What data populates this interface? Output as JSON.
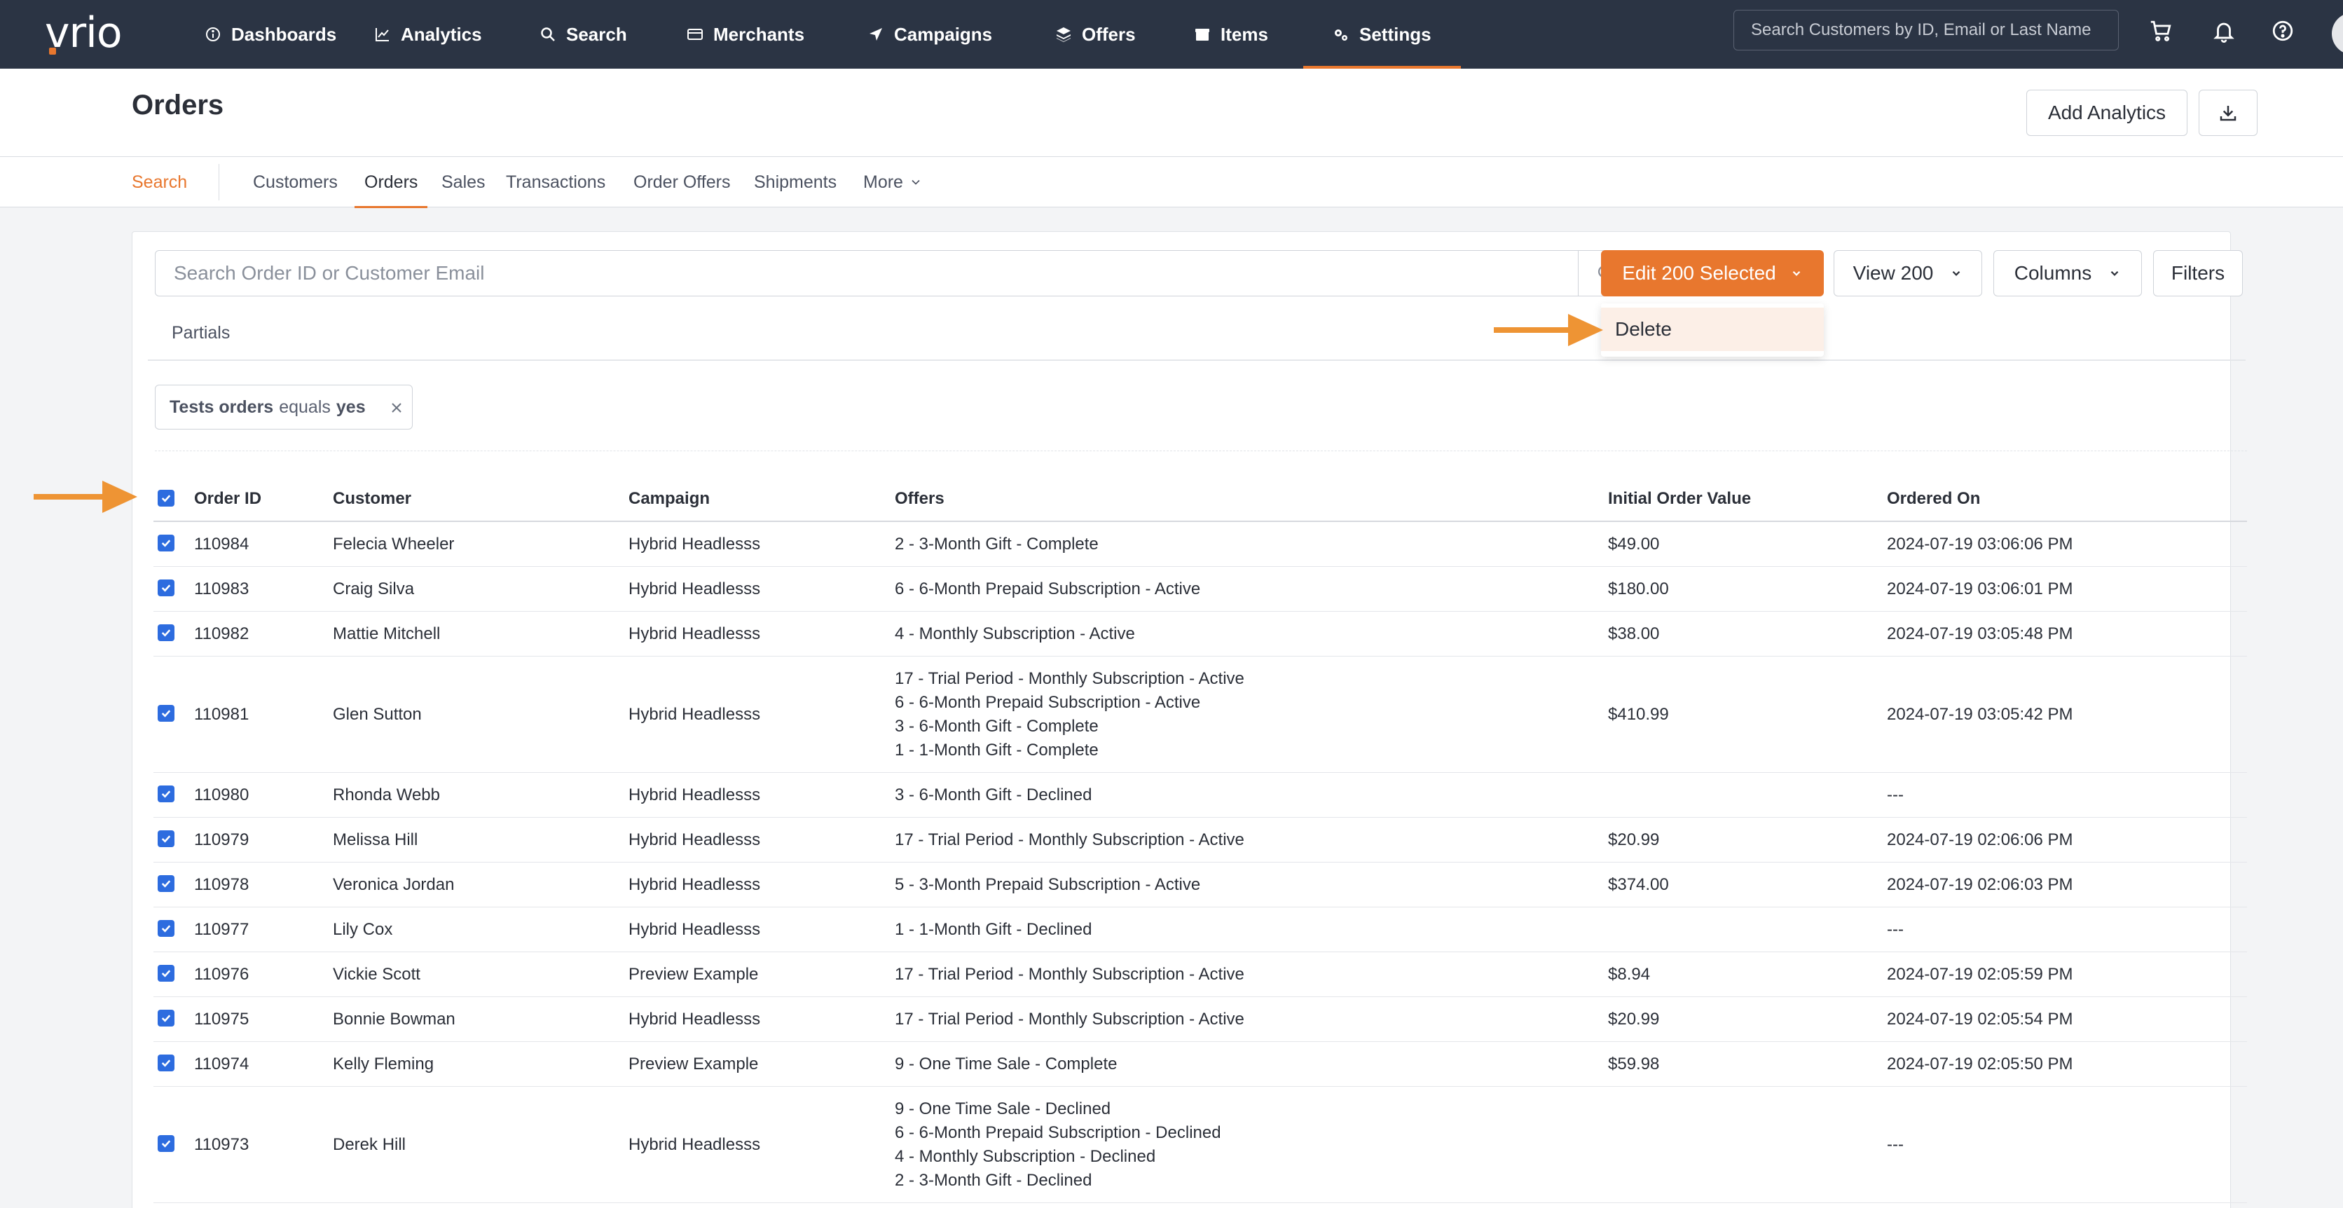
{
  "app": {
    "logo_text": "vrio",
    "colors": {
      "nav_bg": "#2b3444",
      "accent": "#e8772e",
      "checkbox": "#2d6cdf"
    }
  },
  "nav": {
    "items": [
      {
        "label": "Dashboards",
        "icon": "info-icon"
      },
      {
        "label": "Analytics",
        "icon": "chart-line-icon"
      },
      {
        "label": "Search",
        "icon": "search-icon"
      },
      {
        "label": "Merchants",
        "icon": "credit-card-icon"
      },
      {
        "label": "Campaigns",
        "icon": "send-icon"
      },
      {
        "label": "Offers",
        "icon": "layers-icon"
      },
      {
        "label": "Items",
        "icon": "box-icon"
      },
      {
        "label": "Settings",
        "icon": "gears-icon"
      }
    ],
    "search_placeholder": "Search Customers by ID, Email or Last Name"
  },
  "page": {
    "title": "Orders",
    "add_analytics_label": "Add Analytics"
  },
  "subtabs": [
    "Search",
    "Customers",
    "Orders",
    "Sales",
    "Transactions",
    "Order Offers",
    "Shipments",
    "More"
  ],
  "toolbar": {
    "search_placeholder": "Search Order ID or Customer Email",
    "edit_selected_label": "Edit 200 Selected",
    "view_label": "View 200",
    "columns_label": "Columns",
    "filters_label": "Filters",
    "dropdown_delete_label": "Delete"
  },
  "partials_label": "Partials",
  "filter_chip": {
    "field": "Tests orders",
    "operator": "equals",
    "value": "yes"
  },
  "table": {
    "headers": [
      "Order ID",
      "Customer",
      "Campaign",
      "Offers",
      "Initial Order Value",
      "Ordered On"
    ],
    "rows": [
      {
        "id": "110984",
        "customer": "Felecia Wheeler",
        "campaign": "Hybrid Headlesss",
        "offers": [
          "2 - 3-Month Gift - Complete"
        ],
        "value": "$49.00",
        "ordered": "2024-07-19 03:06:06 PM"
      },
      {
        "id": "110983",
        "customer": "Craig Silva",
        "campaign": "Hybrid Headlesss",
        "offers": [
          "6 - 6-Month Prepaid Subscription - Active"
        ],
        "value": "$180.00",
        "ordered": "2024-07-19 03:06:01 PM"
      },
      {
        "id": "110982",
        "customer": "Mattie Mitchell",
        "campaign": "Hybrid Headlesss",
        "offers": [
          "4 - Monthly Subscription - Active"
        ],
        "value": "$38.00",
        "ordered": "2024-07-19 03:05:48 PM"
      },
      {
        "id": "110981",
        "customer": "Glen Sutton",
        "campaign": "Hybrid Headlesss",
        "offers": [
          "17 - Trial Period - Monthly Subscription - Active",
          "6 - 6-Month Prepaid Subscription - Active",
          "3 - 6-Month Gift - Complete",
          "1 - 1-Month Gift - Complete"
        ],
        "value": "$410.99",
        "ordered": "2024-07-19 03:05:42 PM"
      },
      {
        "id": "110980",
        "customer": "Rhonda Webb",
        "campaign": "Hybrid Headlesss",
        "offers": [
          "3 - 6-Month Gift - Declined"
        ],
        "value": "",
        "ordered": "---"
      },
      {
        "id": "110979",
        "customer": "Melissa Hill",
        "campaign": "Hybrid Headlesss",
        "offers": [
          "17 - Trial Period - Monthly Subscription - Active"
        ],
        "value": "$20.99",
        "ordered": "2024-07-19 02:06:06 PM"
      },
      {
        "id": "110978",
        "customer": "Veronica Jordan",
        "campaign": "Hybrid Headlesss",
        "offers": [
          "5 - 3-Month Prepaid Subscription - Active"
        ],
        "value": "$374.00",
        "ordered": "2024-07-19 02:06:03 PM"
      },
      {
        "id": "110977",
        "customer": "Lily Cox",
        "campaign": "Hybrid Headlesss",
        "offers": [
          "1 - 1-Month Gift - Declined"
        ],
        "value": "",
        "ordered": "---"
      },
      {
        "id": "110976",
        "customer": "Vickie Scott",
        "campaign": "Preview Example",
        "offers": [
          "17 - Trial Period - Monthly Subscription - Active"
        ],
        "value": "$8.94",
        "ordered": "2024-07-19 02:05:59 PM"
      },
      {
        "id": "110975",
        "customer": "Bonnie Bowman",
        "campaign": "Hybrid Headlesss",
        "offers": [
          "17 - Trial Period - Monthly Subscription - Active"
        ],
        "value": "$20.99",
        "ordered": "2024-07-19 02:05:54 PM"
      },
      {
        "id": "110974",
        "customer": "Kelly Fleming",
        "campaign": "Preview Example",
        "offers": [
          "9 - One Time Sale - Complete"
        ],
        "value": "$59.98",
        "ordered": "2024-07-19 02:05:50 PM"
      },
      {
        "id": "110973",
        "customer": "Derek Hill",
        "campaign": "Hybrid Headlesss",
        "offers": [
          "9 - One Time Sale - Declined",
          "6 - 6-Month Prepaid Subscription - Declined",
          "4 - Monthly Subscription - Declined",
          "2 - 3-Month Gift - Declined"
        ],
        "value": "",
        "ordered": "---"
      }
    ]
  }
}
